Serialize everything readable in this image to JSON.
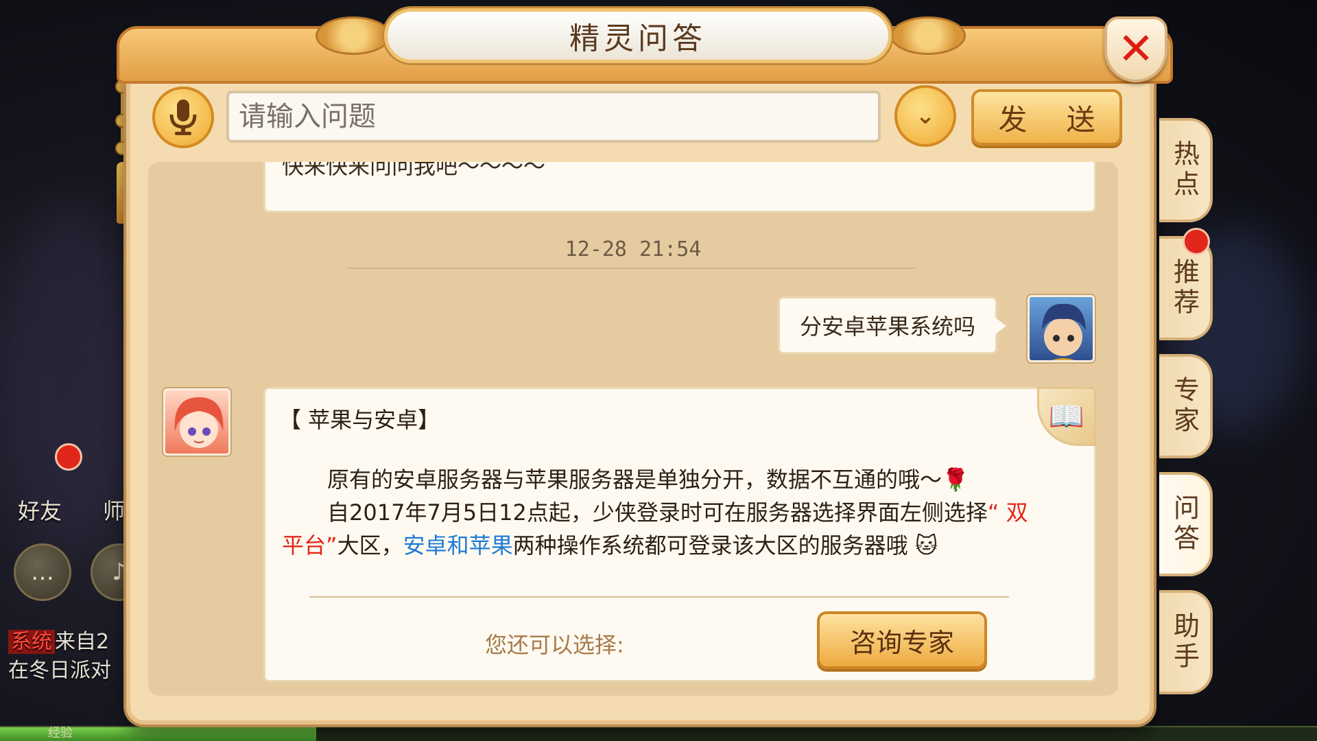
{
  "dialog": {
    "title": "精灵问答",
    "close_symbol": "✕"
  },
  "input": {
    "placeholder": "请输入问题",
    "value": "",
    "send_label": "发 送",
    "dropdown_symbol": "⌄"
  },
  "side_tabs": [
    {
      "label": "热点"
    },
    {
      "label": "推荐"
    },
    {
      "label": "专家"
    },
    {
      "label": "问答"
    },
    {
      "label": "助手"
    }
  ],
  "chat": {
    "previous_message": "快来快来问问我吧～～～～",
    "timestamp": "12-28 21:54",
    "user_message": "分安卓苹果系统吗",
    "answer": {
      "title": "【 苹果与安卓】",
      "line1": "原有的安卓服务器与苹果服务器是单独分开，数据不互通的哦～",
      "line2_a": "自2017年7月5日12点起，少侠登录时可在服务器选择界面左侧选择",
      "line2_red": "“ 双平台”",
      "line2_b": "大区，",
      "line2_blue": "安卓和苹果",
      "line2_c": "两种操作系统都可登录该大区的服务器哦",
      "choose_text": "您还可以选择:",
      "consult_button": "咨询专家"
    }
  },
  "background_hud": {
    "friends_label": "好友",
    "master_label": "师",
    "system_tag": "系统",
    "chat_line1": "来自2",
    "chat_line2": "在冬日派对",
    "exp_label": "经验"
  },
  "colors": {
    "accent_red": "#e1261c",
    "link_blue": "#1f7ad6",
    "panel_bg": "#f4dcb0",
    "button_gold": "#f0b24a"
  }
}
